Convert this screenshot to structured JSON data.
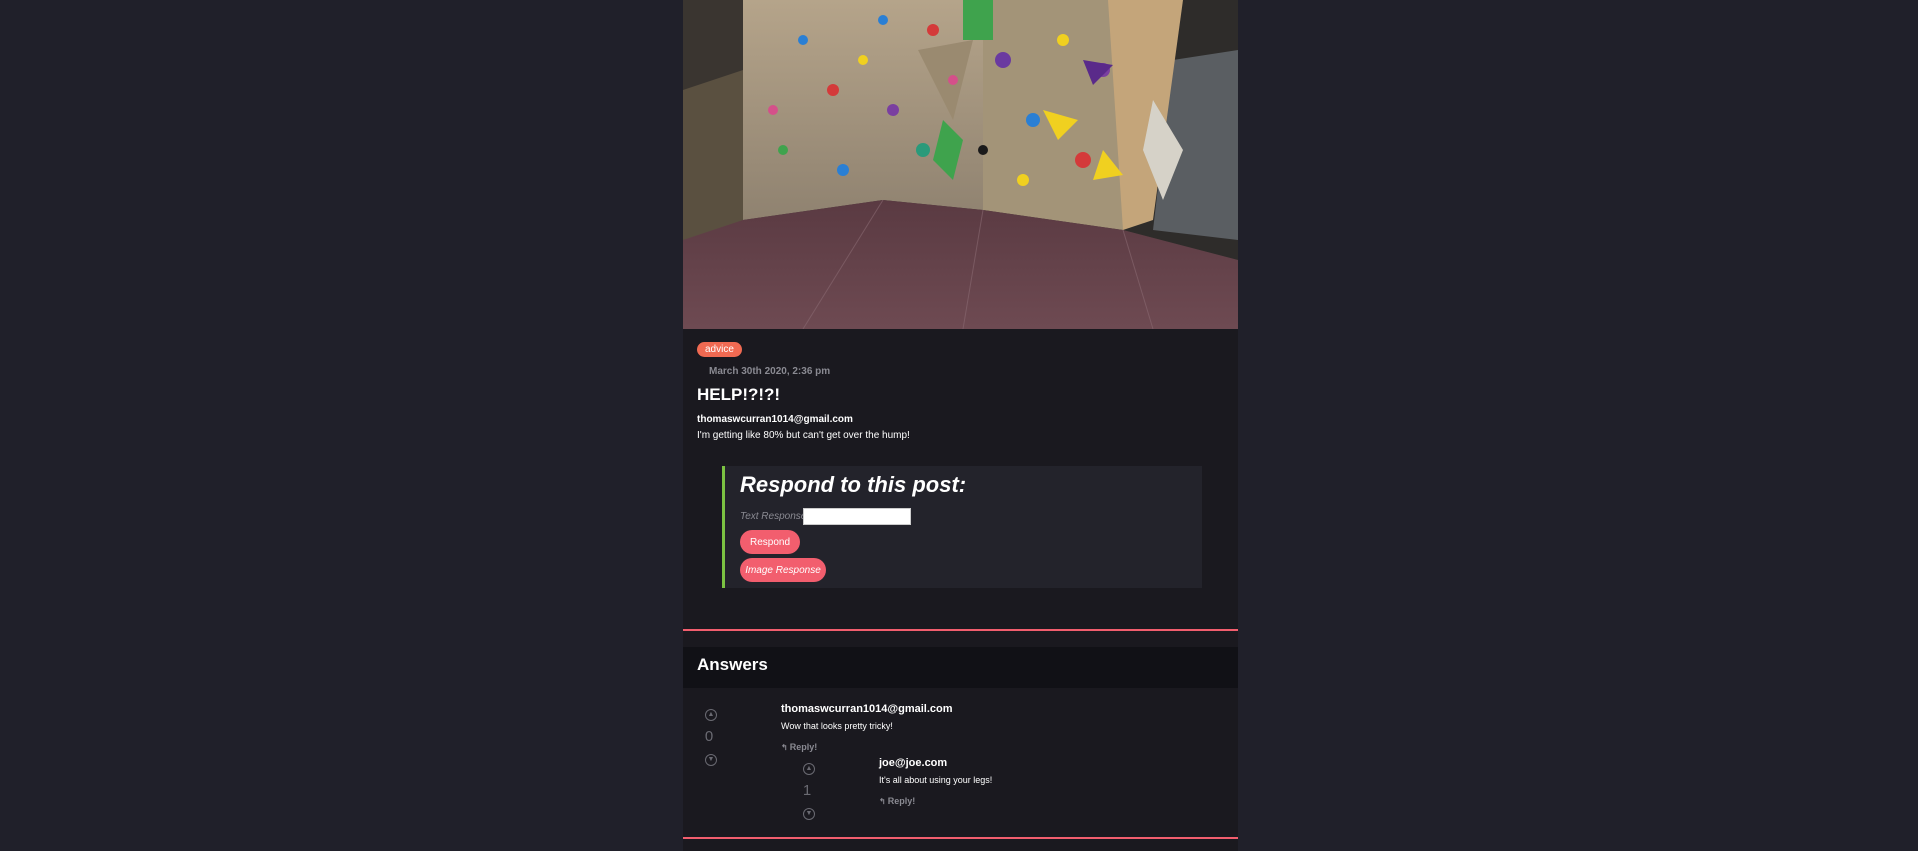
{
  "post": {
    "tag": "advice",
    "date": "March 30th 2020, 2:36 pm",
    "title": "HELP!?!?!",
    "author": "thomaswcurran1014@gmail.com",
    "body": "I'm getting like 80% but can't get over the hump!"
  },
  "respond": {
    "heading": "Respond to this post:",
    "text_label": "Text Response:",
    "text_value": "",
    "respond_button": "Respond",
    "image_button": "Image Response"
  },
  "answers": {
    "heading": "Answers",
    "items": [
      {
        "author": "thomaswcurran1014@gmail.com",
        "text": "Wow that looks pretty tricky!",
        "score": "0",
        "reply_label": "Reply!",
        "replies": [
          {
            "author": "joe@joe.com",
            "text": "It's all about using your legs!",
            "score": "1",
            "reply_label": "Reply!"
          }
        ]
      }
    ]
  },
  "icons": {
    "upvote": "arrow-up-circle-icon",
    "downvote": "arrow-down-circle-icon",
    "reply": "reply-arrow-icon"
  },
  "colors": {
    "page_background": "#20202a",
    "column_background": "#1a191f",
    "tag": "#f06a52",
    "button": "#f25e6e",
    "accent_border": "#7bc242",
    "divider": "#f25e6e"
  }
}
